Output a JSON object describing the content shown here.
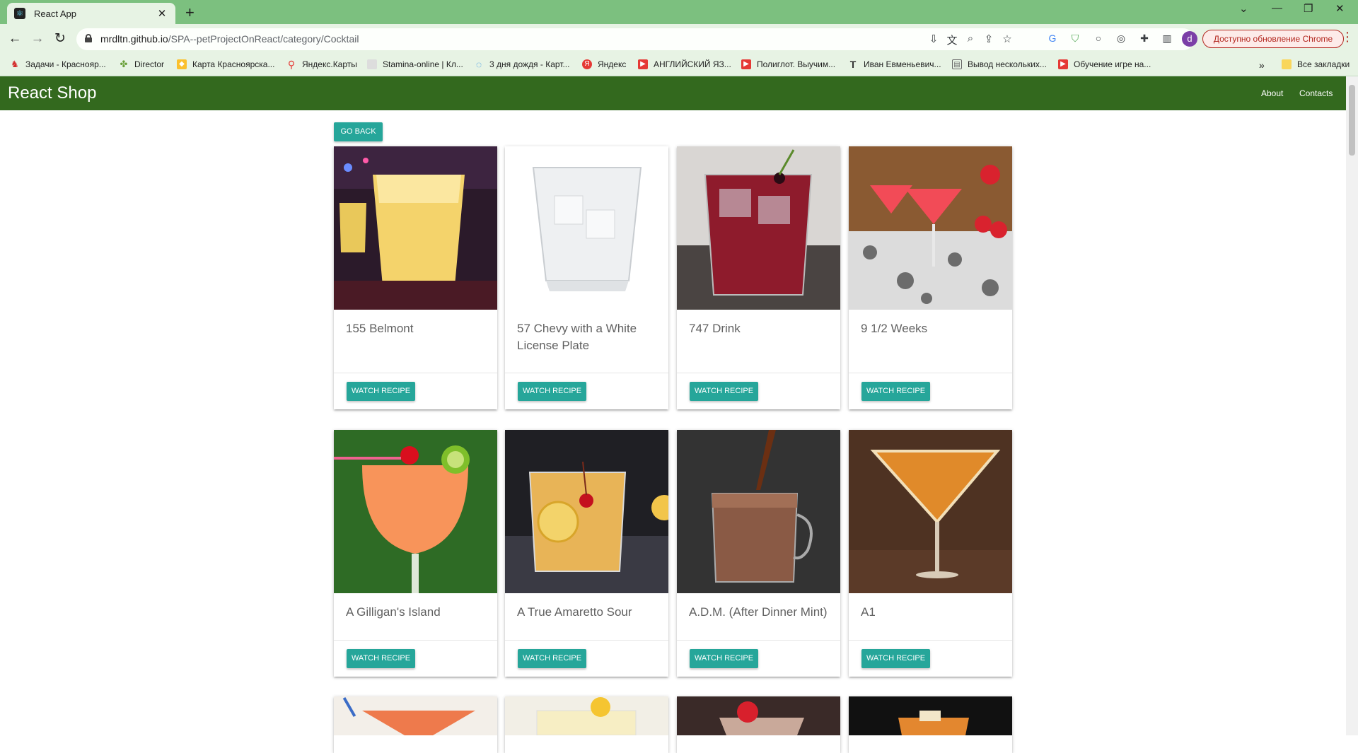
{
  "browser": {
    "tab_title": "React App",
    "url_host": "mrdltn.github.io",
    "url_path": "/SPA--petProjectOnReact/category/Cocktail",
    "profile_initial": "d",
    "update_label": "Доступно обновление Chrome",
    "bookmarks": [
      "Задачи - Краснояр...",
      "Director",
      "Карта Красноярска...",
      "Яндекс.Карты",
      "Stamina-online | Кл...",
      "3 дня дождя - Карт...",
      "Яндекс",
      "АНГЛИЙСКИЙ ЯЗ...",
      "Полиглот. Выучим...",
      "Иван Евменьевич...",
      "Вывод нескольких...",
      "Обучение игре на..."
    ],
    "all_bookmarks": "Все закладки"
  },
  "navbar": {
    "brand": "React Shop",
    "links": [
      "About",
      "Contacts"
    ]
  },
  "go_back": "Go Back",
  "watch_label": "Watch recipe",
  "cocktails": [
    {
      "name": "155 Belmont"
    },
    {
      "name": "57 Chevy with a White License Plate"
    },
    {
      "name": "747 Drink"
    },
    {
      "name": "9 1/2 Weeks"
    },
    {
      "name": "A Gilligan's Island"
    },
    {
      "name": "A True Amaretto Sour"
    },
    {
      "name": "A.D.M. (After Dinner Mint)"
    },
    {
      "name": "A1"
    }
  ],
  "colors": {
    "navbar": "#33691e",
    "button": "#26a69a",
    "tabstrip": "#7cc07f",
    "toolbar": "#e7f3e4"
  }
}
